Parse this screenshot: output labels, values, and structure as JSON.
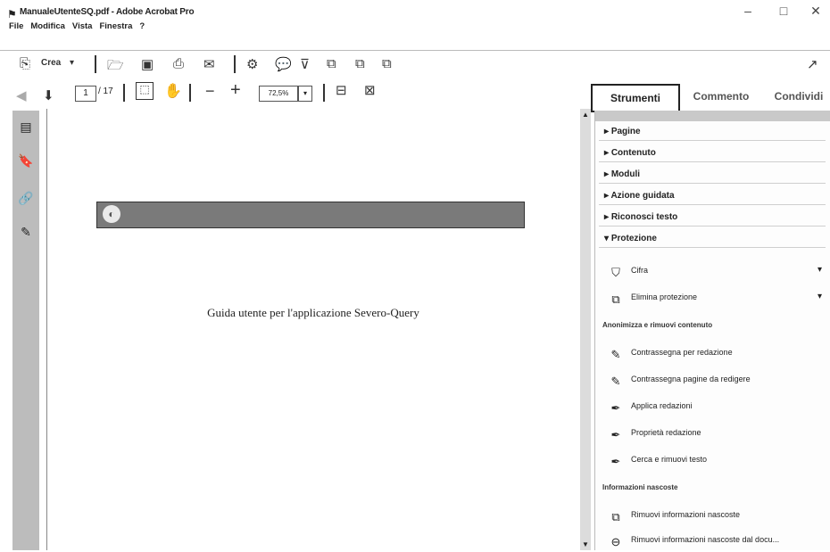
{
  "window": {
    "title": "ManualeUtenteSQ.pdf - Adobe Acrobat Pro",
    "minimize": "–",
    "maximize": "□",
    "close": "✕"
  },
  "menu": [
    "File",
    "Modifica",
    "Vista",
    "Finestra",
    "?"
  ],
  "toolbar": {
    "create_label": "Crea",
    "page_current": "1",
    "page_total": "/ 17",
    "zoom": "72,5%"
  },
  "tabs": [
    {
      "label": "Strumenti",
      "active": true
    },
    {
      "label": "Commento",
      "active": false
    },
    {
      "label": "Condividi",
      "active": false
    }
  ],
  "document": {
    "heading": "Guida utente per l'applicazione Severo-Query"
  },
  "panel": {
    "sections": [
      {
        "label": "Pagine",
        "expanded": false
      },
      {
        "label": "Contenuto",
        "expanded": false
      },
      {
        "label": "Moduli",
        "expanded": false
      },
      {
        "label": "Azione guidata",
        "expanded": false
      },
      {
        "label": "Riconosci testo",
        "expanded": false
      },
      {
        "label": "Protezione",
        "expanded": true
      }
    ],
    "protection_items": [
      {
        "label": "Cifra",
        "icon": "shield-icon"
      },
      {
        "label": "Elimina protezione",
        "icon": "unlock-doc-icon"
      }
    ],
    "group1_label": "Anonimizza e rimuovi contenuto",
    "redaction_items": [
      {
        "label": "Contrassegna per redazione",
        "icon": "mark-redaction-icon"
      },
      {
        "label": "Contrassegna pagine da redigere",
        "icon": "mark-pages-icon"
      },
      {
        "label": "Applica redazioni",
        "icon": "apply-redaction-icon"
      },
      {
        "label": "Proprietà redazione",
        "icon": "redaction-properties-icon"
      },
      {
        "label": "Cerca e rimuovi testo",
        "icon": "search-remove-icon"
      }
    ],
    "group2_label": "Informazioni nascoste",
    "hidden_items": [
      {
        "label": "Rimuovi informazioni nascoste",
        "icon": "remove-hidden-icon"
      },
      {
        "label": "Rimuovi informazioni nascoste dal docu...",
        "icon": "remove-hidden-doc-icon"
      }
    ]
  }
}
